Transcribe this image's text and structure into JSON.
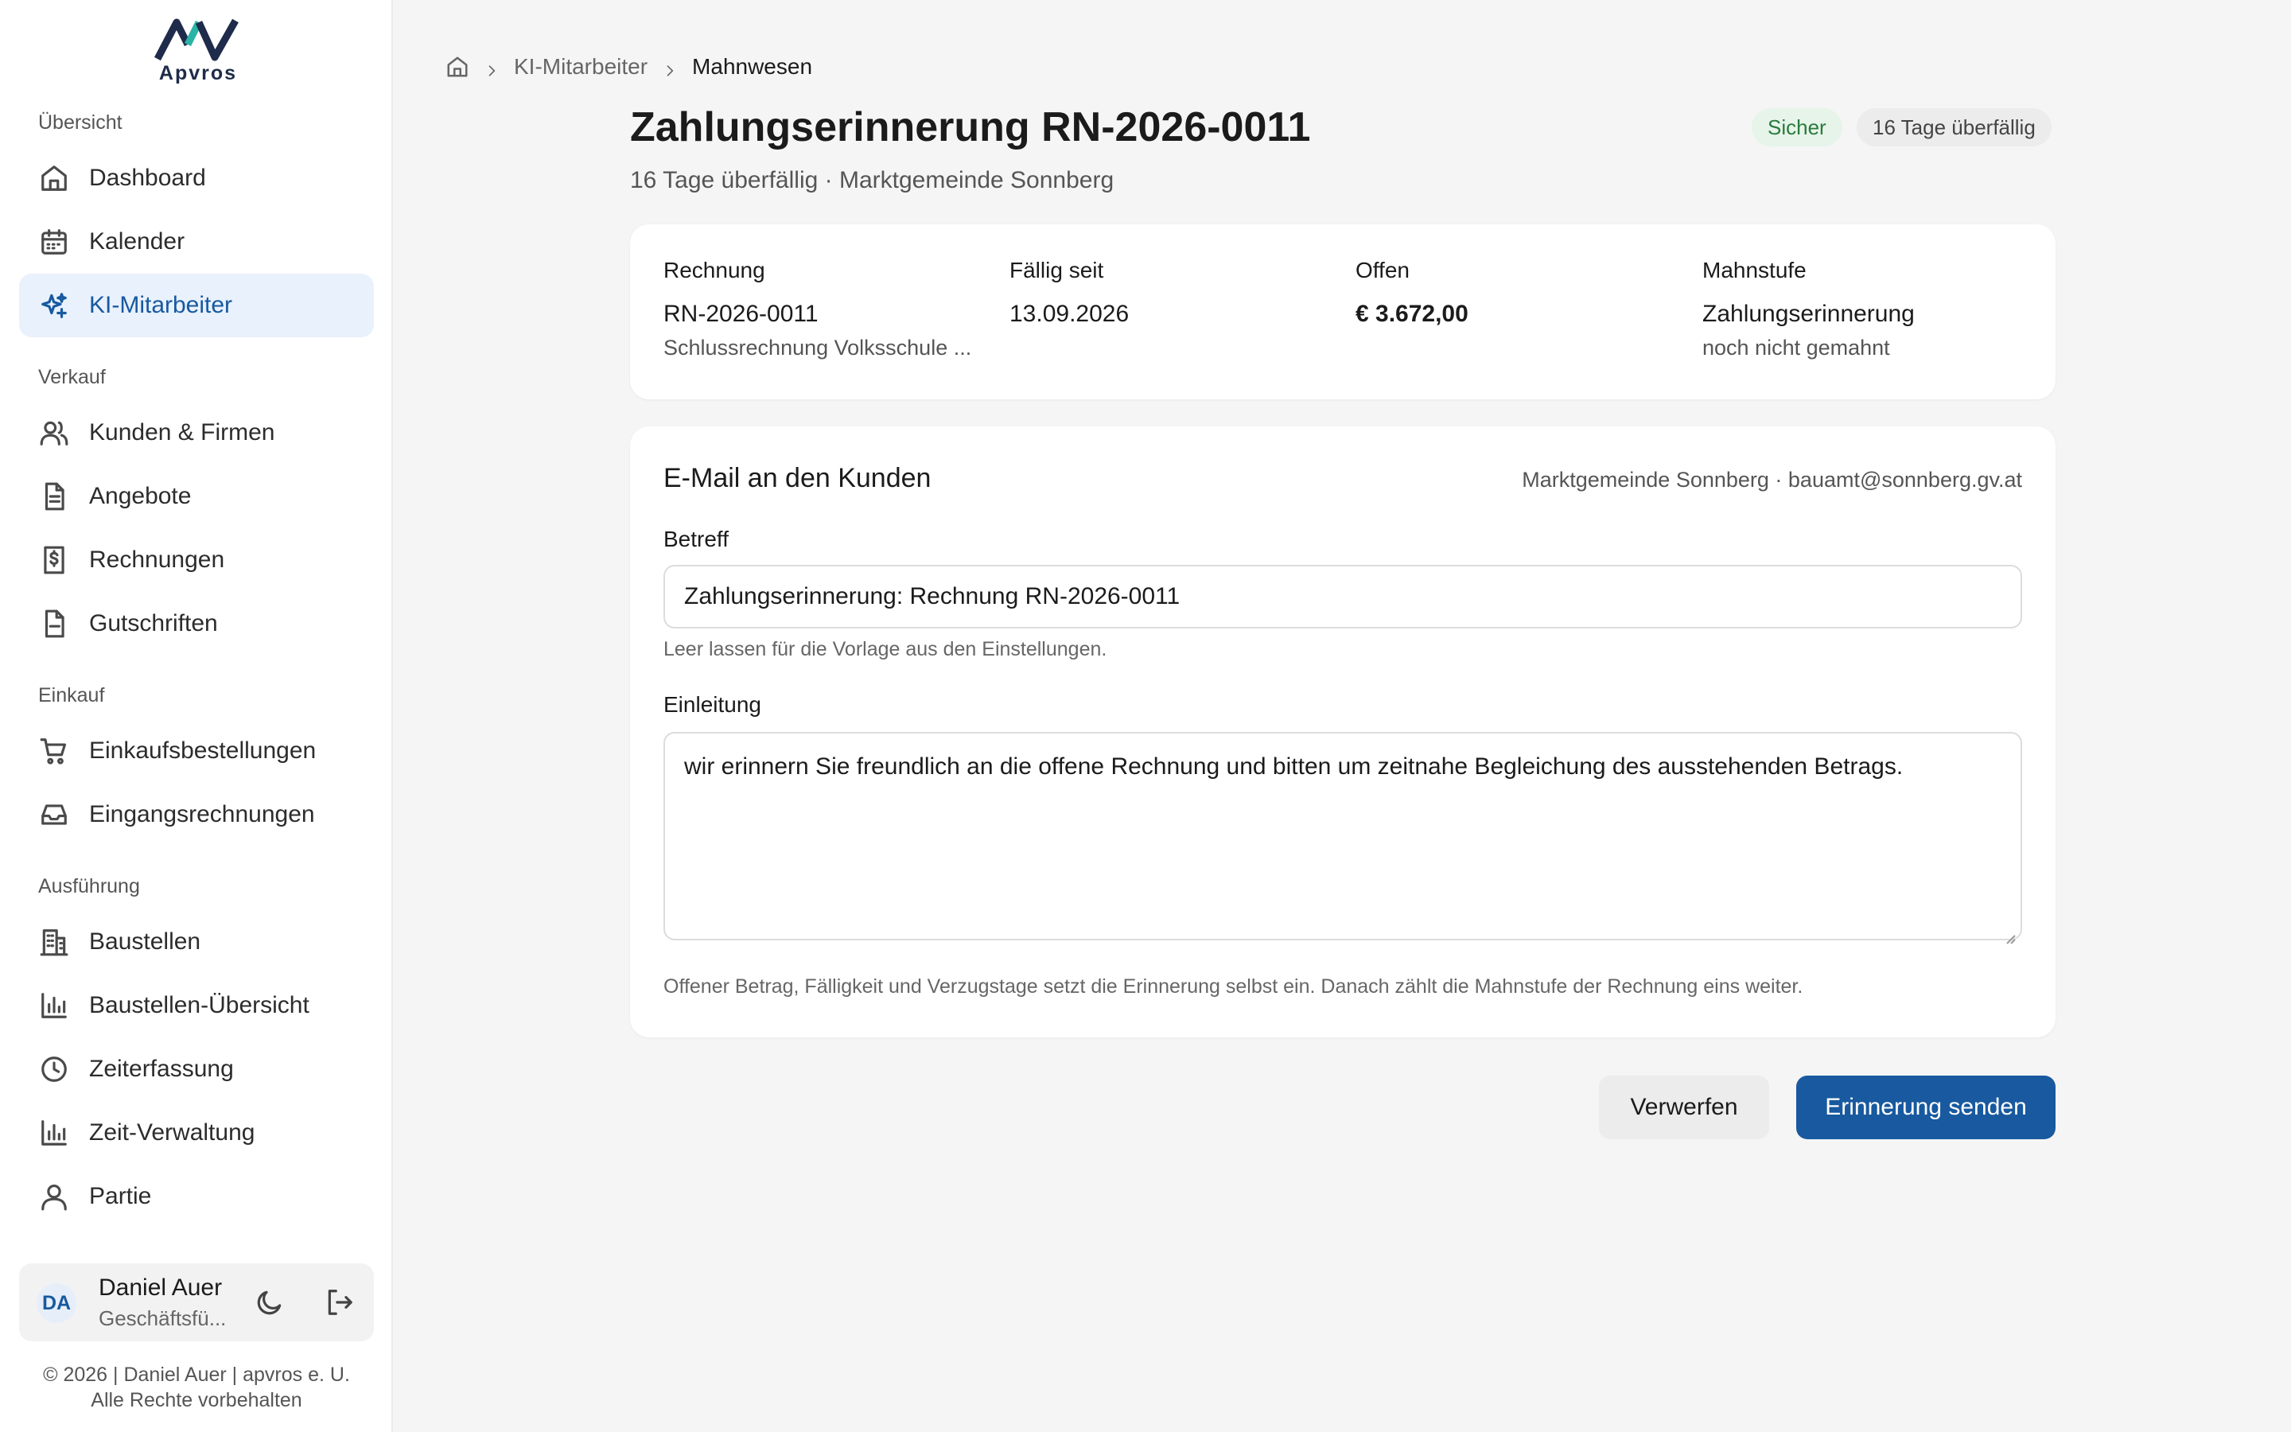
{
  "app": {
    "logo_text": "Apvros",
    "brand_color": "#18599f"
  },
  "sidebar": {
    "sections": {
      "overview": "Übersicht",
      "sales": "Verkauf",
      "purchase": "Einkauf",
      "execution": "Ausführung"
    },
    "items": {
      "dashboard": "Dashboard",
      "calendar": "Kalender",
      "ai_staff": "KI-Mitarbeiter",
      "customers": "Kunden & Firmen",
      "offers": "Angebote",
      "invoices": "Rechnungen",
      "credits": "Gutschriften",
      "purchase_orders": "Einkaufsbestellungen",
      "incoming_invoices": "Eingangsrechnungen",
      "sites": "Baustellen",
      "sites_overview": "Baustellen-Übersicht",
      "time_tracking": "Zeiterfassung",
      "time_admin": "Zeit-Verwaltung",
      "crew": "Partie"
    },
    "user": {
      "initials": "DA",
      "name": "Daniel Auer",
      "role": "Geschäftsfü..."
    },
    "footer": {
      "line1": "© 2026 | Daniel Auer | apvros e. U.",
      "line2": "Alle Rechte vorbehalten"
    }
  },
  "breadcrumb": {
    "parent": "KI-Mitarbeiter",
    "current": "Mahnwesen"
  },
  "header": {
    "title": "Zahlungserinnerung RN-2026-0011",
    "subtitle": "16 Tage überfällig · Marktgemeinde Sonnberg",
    "badge_safe": "Sicher",
    "badge_overdue": "16 Tage überfällig"
  },
  "info": {
    "invoice_label": "Rechnung",
    "invoice_value": "RN-2026-0011",
    "invoice_sub": "Schlussrechnung Volksschule ...",
    "due_label": "Fällig seit",
    "due_value": "13.09.2026",
    "open_label": "Offen",
    "open_value": "€ 3.672,00",
    "level_label": "Mahnstufe",
    "level_value": "Zahlungserinnerung",
    "level_sub": "noch nicht gemahnt"
  },
  "email": {
    "title": "E-Mail an den Kunden",
    "recipient": "Marktgemeinde Sonnberg · bauamt@sonnberg.gv.at",
    "subject_label": "Betreff",
    "subject_value": "Zahlungserinnerung: Rechnung RN-2026-0011",
    "subject_hint": "Leer lassen für die Vorlage aus den Einstellungen.",
    "intro_label": "Einleitung",
    "intro_value": "wir erinnern Sie freundlich an die offene Rechnung und bitten um zeitnahe Begleichung des ausstehenden Betrags.",
    "footer_hint": "Offener Betrag, Fälligkeit und Verzugstage setzt die Erinnerung selbst ein. Danach zählt die Mahnstufe der Rechnung eins weiter."
  },
  "actions": {
    "discard": "Verwerfen",
    "send": "Erinnerung senden"
  }
}
